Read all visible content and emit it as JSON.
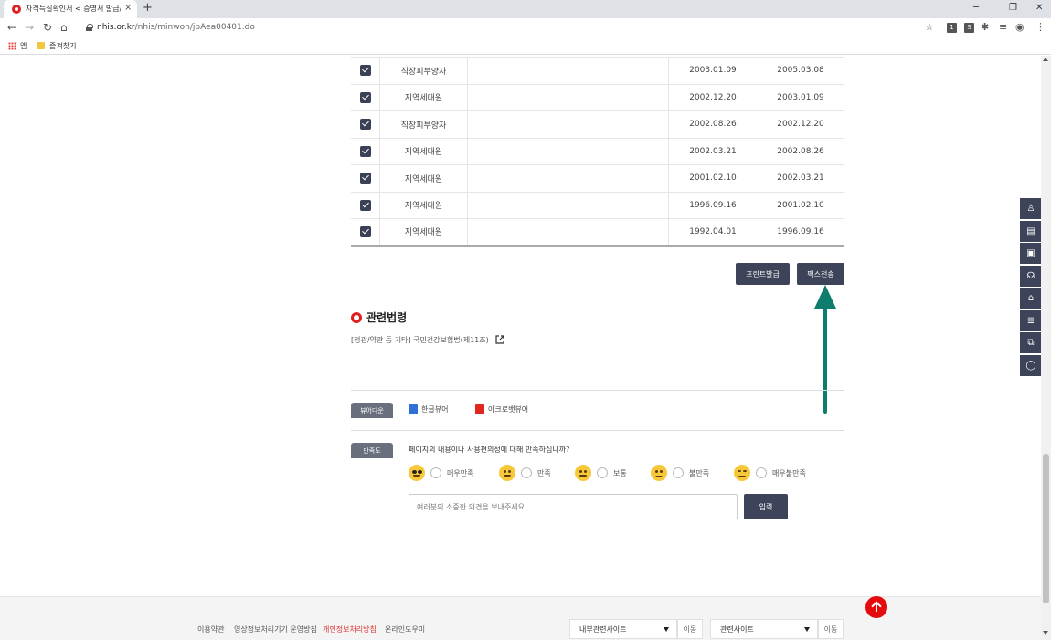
{
  "browser": {
    "tab_title": "자격득실확인서 < 증명서 발급/",
    "tab_close": "×",
    "new_tab": "+",
    "url_host": "nhis.or.kr",
    "url_path": "/nhis/minwon/jpAea00401.do",
    "bookmarks": {
      "apps": "앱",
      "favorites": "즐겨찾기"
    },
    "ext_labels": [
      "1",
      "S"
    ]
  },
  "table": {
    "rows": [
      {
        "type": "직장피부양자",
        "from": "2003.01.09",
        "to": "2005.03.08",
        "checked": true
      },
      {
        "type": "지역세대원",
        "from": "2002.12.20",
        "to": "2003.01.09",
        "checked": true
      },
      {
        "type": "직장피부양자",
        "from": "2002.08.26",
        "to": "2002.12.20",
        "checked": true
      },
      {
        "type": "지역세대원",
        "from": "2002.03.21",
        "to": "2002.08.26",
        "checked": true
      },
      {
        "type": "지역세대원",
        "from": "2001.02.10",
        "to": "2002.03.21",
        "checked": true
      },
      {
        "type": "지역세대원",
        "from": "1996.09.16",
        "to": "2001.02.10",
        "checked": true
      },
      {
        "type": "지역세대원",
        "from": "1992.04.01",
        "to": "1996.09.16",
        "checked": true
      }
    ]
  },
  "actions": {
    "print": "프린트발급",
    "fax": "팩스전송"
  },
  "related_law": {
    "title": "관련법령",
    "link": "[정관/약관 등 기타] 국민건강보험법(제11조)"
  },
  "viewer": {
    "label": "뷰어다운",
    "hangul": "한글뷰어",
    "acrobat": "아크로뱃뷰어"
  },
  "survey": {
    "label": "만족도",
    "question": "페이지의 내용이나 사용편의성에 대해 만족하십니까?",
    "options": [
      "매우만족",
      "만족",
      "보통",
      "불만족",
      "매우불만족"
    ],
    "input_placeholder": "여러분의 소중한 의견을 보내주세요",
    "submit": "입력"
  },
  "footer": {
    "links": [
      "이용약관",
      "영상정보처리기기 운영방침",
      "개인정보처리방침",
      "온라인도우미"
    ],
    "select1": "내부관련사이트",
    "select2": "관련사이트",
    "go": "이동"
  },
  "colors": {
    "accent": "#e30b0b",
    "dark_button": "#3d4359",
    "arrow": "#0f7d6e"
  }
}
